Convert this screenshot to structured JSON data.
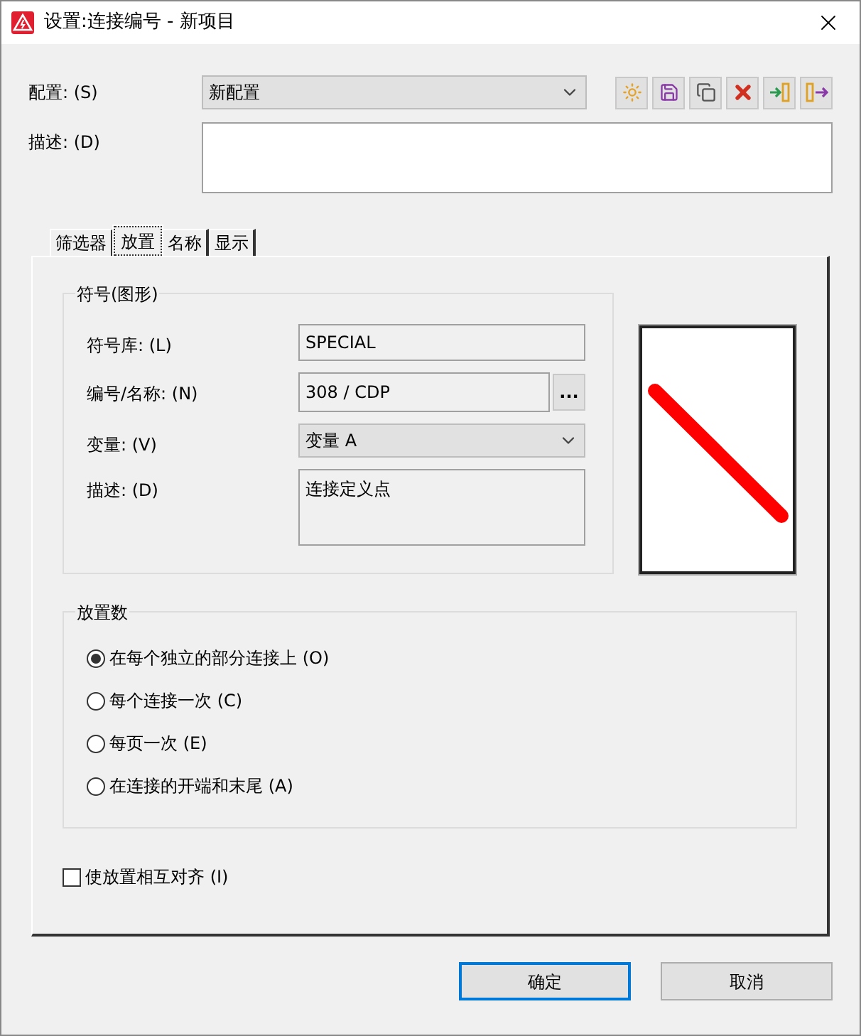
{
  "window": {
    "title": "设置:连接编号 - 新项目"
  },
  "config": {
    "label": "配置: (S)",
    "value": "新配置"
  },
  "toolbar": [
    {
      "kind": "new"
    },
    {
      "kind": "save"
    },
    {
      "kind": "copy"
    },
    {
      "kind": "delete"
    },
    {
      "kind": "import"
    },
    {
      "kind": "export"
    }
  ],
  "description": {
    "label": "描述: (D)"
  },
  "tabs": [
    {
      "label": "筛选器",
      "selected": false
    },
    {
      "label": "放置",
      "selected": true
    },
    {
      "label": "名称",
      "selected": false
    },
    {
      "label": "显示",
      "selected": false
    }
  ],
  "symbol_group": {
    "title": "符号(图形)",
    "rows": [
      {
        "kind": "text",
        "label": "符号库: (L)",
        "value": "SPECIAL"
      },
      {
        "kind": "browse",
        "label": "编号/名称: (N)",
        "value": "308 / CDP",
        "button": "..."
      },
      {
        "kind": "select",
        "label": "变量: (V)",
        "value": "变量 A"
      },
      {
        "kind": "memo",
        "label": "描述: (D)",
        "value": "连接定义点"
      }
    ]
  },
  "placement_group": {
    "title": "放置数",
    "options": [
      {
        "label": "在每个独立的部分连接上 (O)",
        "selected": true
      },
      {
        "label": "每个连接一次 (C)",
        "selected": false
      },
      {
        "label": "每页一次 (E)",
        "selected": false
      },
      {
        "label": "在连接的开端和末尾 (A)",
        "selected": false
      }
    ]
  },
  "align_checkbox": {
    "label": "使放置相互对齐 (I)",
    "checked": false
  },
  "buttons": [
    {
      "label": "确定",
      "default": true
    },
    {
      "label": "取消",
      "default": false
    }
  ]
}
